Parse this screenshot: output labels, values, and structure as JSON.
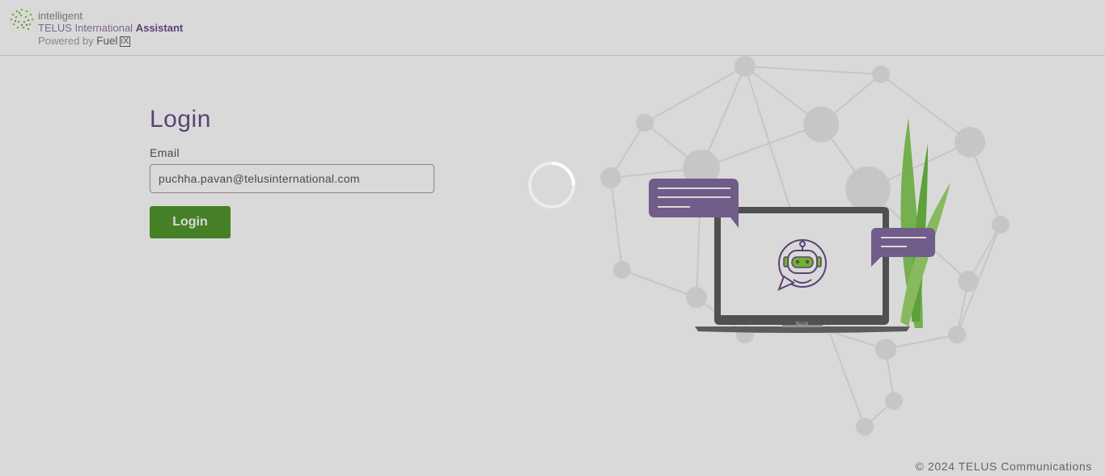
{
  "header": {
    "brand_line1": "intelligent",
    "brand_line2_prefix": "TELUS International",
    "brand_line2_bold": "Assistant",
    "powered_by": "Powered by",
    "fuel": "Fuel",
    "ix": "iX",
    "logo_icon": "brain-network-icon"
  },
  "login": {
    "title": "Login",
    "email_label": "Email",
    "email_value": "puchha.pavan@telusinternational.com",
    "button_label": "Login"
  },
  "illustration": {
    "icon": "chatbot-laptop-illustration",
    "laptop_brand": "TELUS"
  },
  "loading": {
    "icon": "loading-spinner-icon"
  },
  "footer": {
    "copyright": "© 2024 TELUS Communications"
  },
  "colors": {
    "brand_purple": "#4b286d",
    "brand_green": "#2b8000",
    "bubble_purple": "#6b4c8f",
    "leaf_green": "#66cc00"
  }
}
